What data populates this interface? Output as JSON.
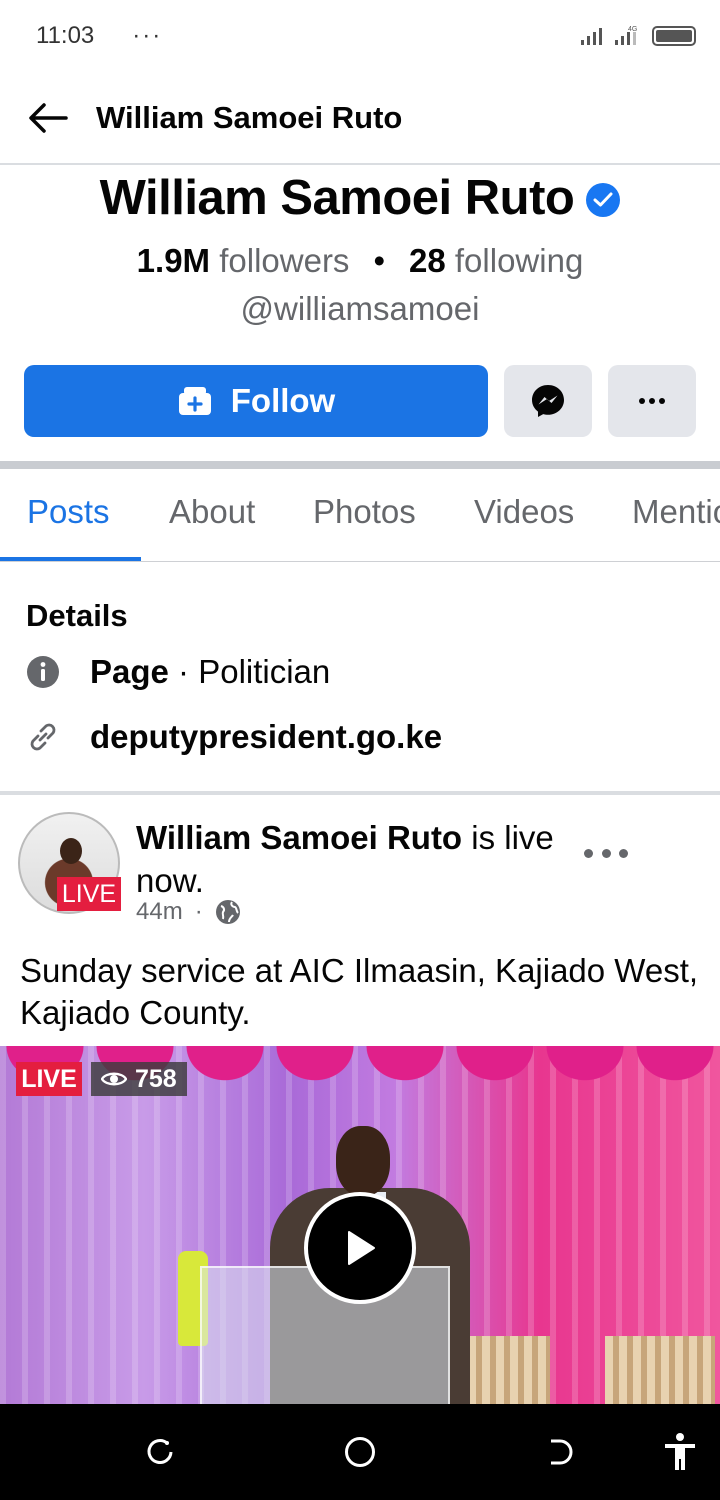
{
  "status_bar": {
    "time": "11:03",
    "dots": "···",
    "network": "4G"
  },
  "top_bar": {
    "title": "William Samoei Ruto"
  },
  "profile": {
    "name": "William Samoei Ruto",
    "followers_count": "1.9M",
    "followers_label": "followers",
    "separator": "•",
    "following_count": "28",
    "following_label": "following",
    "handle": "@williamsamoei"
  },
  "actions": {
    "follow_label": "Follow"
  },
  "tabs": [
    {
      "label": "Posts"
    },
    {
      "label": "About"
    },
    {
      "label": "Photos"
    },
    {
      "label": "Videos"
    },
    {
      "label": "Mentions"
    }
  ],
  "details": {
    "heading": "Details",
    "page_label": "Page",
    "page_category": " · Politician",
    "website": "deputypresident.go.ke"
  },
  "post": {
    "author": "William Samoei Ruto",
    "status": " is live now.",
    "live_badge": "LIVE",
    "time": "44m",
    "meta_sep": "·",
    "text": "Sunday service at AIC Ilmaasin, Kajiado West, Kajiado County.",
    "video": {
      "live_label": "LIVE",
      "viewers": "758"
    }
  },
  "colors": {
    "accent": "#1b74e4",
    "live": "#e41e3f",
    "verified": "#1877f2"
  }
}
